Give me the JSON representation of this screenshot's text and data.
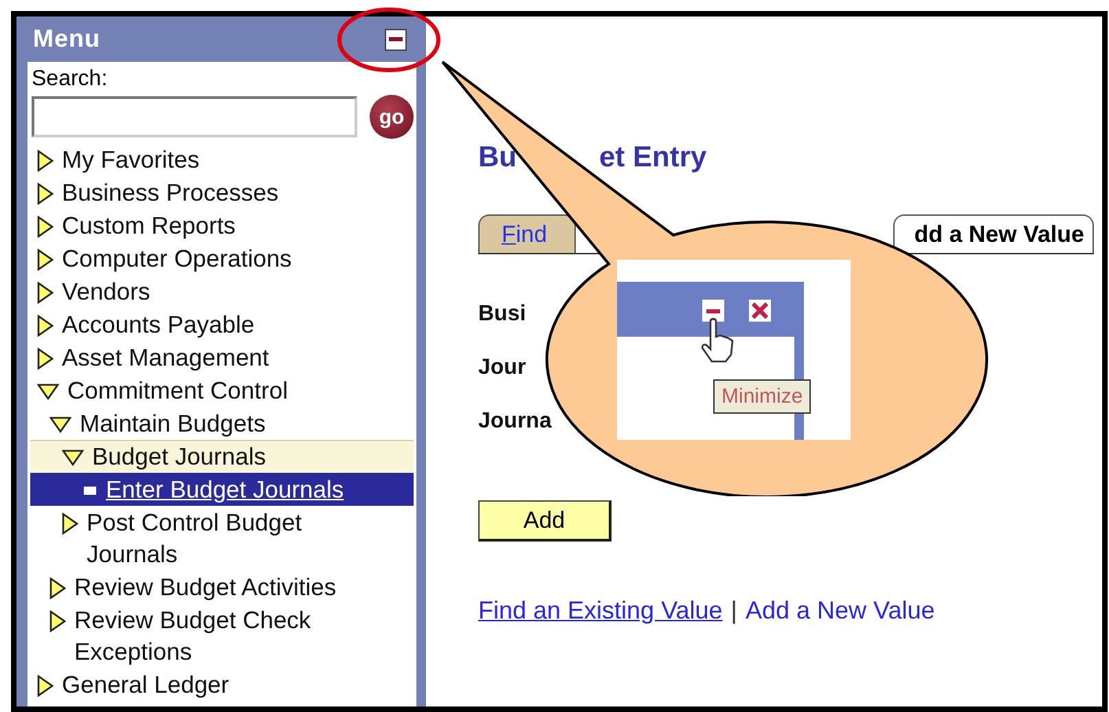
{
  "menu": {
    "title": "Menu",
    "search_label": "Search:",
    "go_button": "go",
    "items": [
      {
        "label": "My Favorites",
        "expanded": false,
        "selected": false,
        "highlighted": false
      },
      {
        "label": "Business Processes",
        "expanded": false,
        "selected": false,
        "highlighted": false
      },
      {
        "label": "Custom Reports",
        "expanded": false,
        "selected": false,
        "highlighted": false
      },
      {
        "label": "Computer Operations",
        "expanded": false,
        "selected": false,
        "highlighted": false
      },
      {
        "label": "Vendors",
        "expanded": false,
        "selected": false,
        "highlighted": false
      },
      {
        "label": "Accounts Payable",
        "expanded": false,
        "selected": false,
        "highlighted": false
      },
      {
        "label": "Asset Management",
        "expanded": false,
        "selected": false,
        "highlighted": false
      },
      {
        "label": "Commitment Control",
        "expanded": true,
        "selected": false,
        "highlighted": false,
        "children": [
          {
            "label": "Maintain Budgets",
            "expanded": true,
            "selected": false,
            "highlighted": false,
            "children": [
              {
                "label": "Budget Journals",
                "expanded": true,
                "selected": false,
                "highlighted": true,
                "children": [
                  {
                    "label": "Enter Budget Journals",
                    "kind": "leaf",
                    "selected": true,
                    "highlighted": false
                  }
                ]
              },
              {
                "label": "Post Control Budget Journals",
                "expanded": false,
                "selected": false,
                "highlighted": false
              }
            ]
          },
          {
            "label": "Review Budget Activities",
            "expanded": false,
            "selected": false,
            "highlighted": false
          },
          {
            "label": "Review Budget Check Exceptions",
            "expanded": false,
            "selected": false,
            "highlighted": false
          }
        ]
      },
      {
        "label": "General Ledger",
        "expanded": false,
        "selected": false,
        "highlighted": false
      }
    ]
  },
  "content": {
    "title_parts": [
      "Bu",
      "et Entry"
    ],
    "tabs": [
      {
        "label": "Find",
        "selected": false
      },
      {
        "label": "dd a New Value",
        "selected": true
      }
    ],
    "field_labels": [
      "Busi",
      "Jour",
      "Journa"
    ],
    "add_button": "Add",
    "links": [
      {
        "label": "Find an Existing Value",
        "current": false
      },
      {
        "label": "Add a New Value",
        "current": true
      }
    ],
    "link_separator": "|"
  },
  "callout": {
    "tooltip": "Minimize"
  }
}
